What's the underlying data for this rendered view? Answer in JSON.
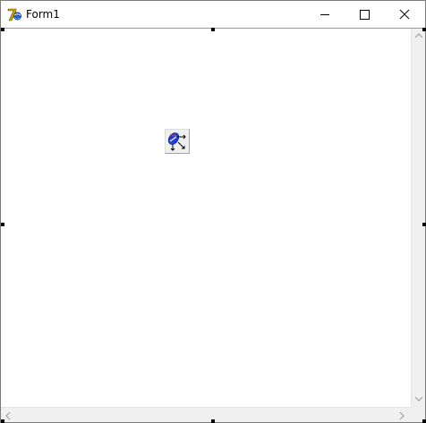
{
  "window": {
    "title": "Form1"
  },
  "titlebar": {
    "minimize_icon": "minimize-icon",
    "maximize_icon": "maximize-icon",
    "close_icon": "close-icon"
  },
  "component": {
    "icon": "transform-component-icon"
  },
  "colors": {
    "titlebar_bg": "#ffffff",
    "client_bg": "#ffffff",
    "scrollbar_bg": "#f0f0f0",
    "handle": "#000000"
  }
}
